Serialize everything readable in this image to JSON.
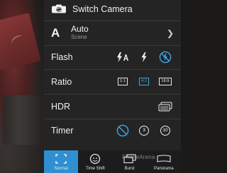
{
  "menu": {
    "switch_camera": {
      "label": "Switch Camera"
    },
    "scene": {
      "icon_letter": "A",
      "value": "Auto",
      "label": "Scene"
    },
    "flash": {
      "label": "Flash",
      "options": [
        "flash-auto",
        "flash-on",
        "flash-off"
      ],
      "selected": "flash-off"
    },
    "ratio": {
      "label": "Ratio",
      "options": [
        "1:1",
        "4:3",
        "16:9"
      ],
      "selected": "4:3"
    },
    "hdr": {
      "label": "HDR"
    },
    "timer": {
      "label": "Timer",
      "options": [
        "3",
        "10"
      ]
    }
  },
  "modes": [
    {
      "label": "Normal",
      "icon": "normal-frame-icon",
      "active": true
    },
    {
      "label": "Time Shift",
      "icon": "time-shift-icon",
      "active": false
    },
    {
      "label": "Burst",
      "icon": "burst-icon",
      "active": false
    },
    {
      "label": "Panorama",
      "icon": "panorama-icon",
      "active": false
    }
  ],
  "watermark": "PhoneArena",
  "colors": {
    "accent": "#3fa9e0",
    "mode_active": "#2f8fd0",
    "panel": "#242424"
  }
}
